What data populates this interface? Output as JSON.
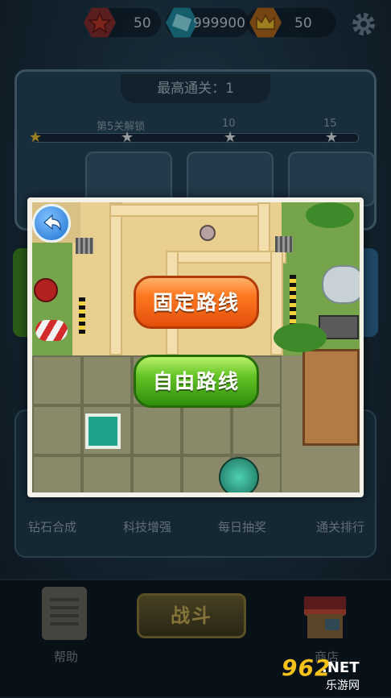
{
  "resources": {
    "stars": "50",
    "gems": "999900",
    "crowns": "50"
  },
  "icons": {
    "star": "star-icon",
    "gem": "gem-icon",
    "crown": "crown-icon",
    "settings": "gear-icon",
    "back": "back-arrow-icon"
  },
  "progress": {
    "best_label": "最高通关：1",
    "milestone_text": "第5关解锁",
    "milestone_10": "10",
    "milestone_15": "15"
  },
  "route_dialog": {
    "fixed_route": "固定路线",
    "free_route": "自由路线"
  },
  "menu": {
    "items": [
      "钻石合成",
      "科技增强",
      "每日抽奖",
      "通关排行"
    ]
  },
  "bottom_nav": {
    "help": "帮助",
    "battle": "战斗",
    "shop": "商店"
  },
  "watermark": {
    "number": "962",
    "domain": ".NET",
    "sub": "乐游网"
  },
  "colors": {
    "fixed_button": "#ff7a22",
    "free_button": "#63c324",
    "back_button": "#1e6fd0"
  }
}
